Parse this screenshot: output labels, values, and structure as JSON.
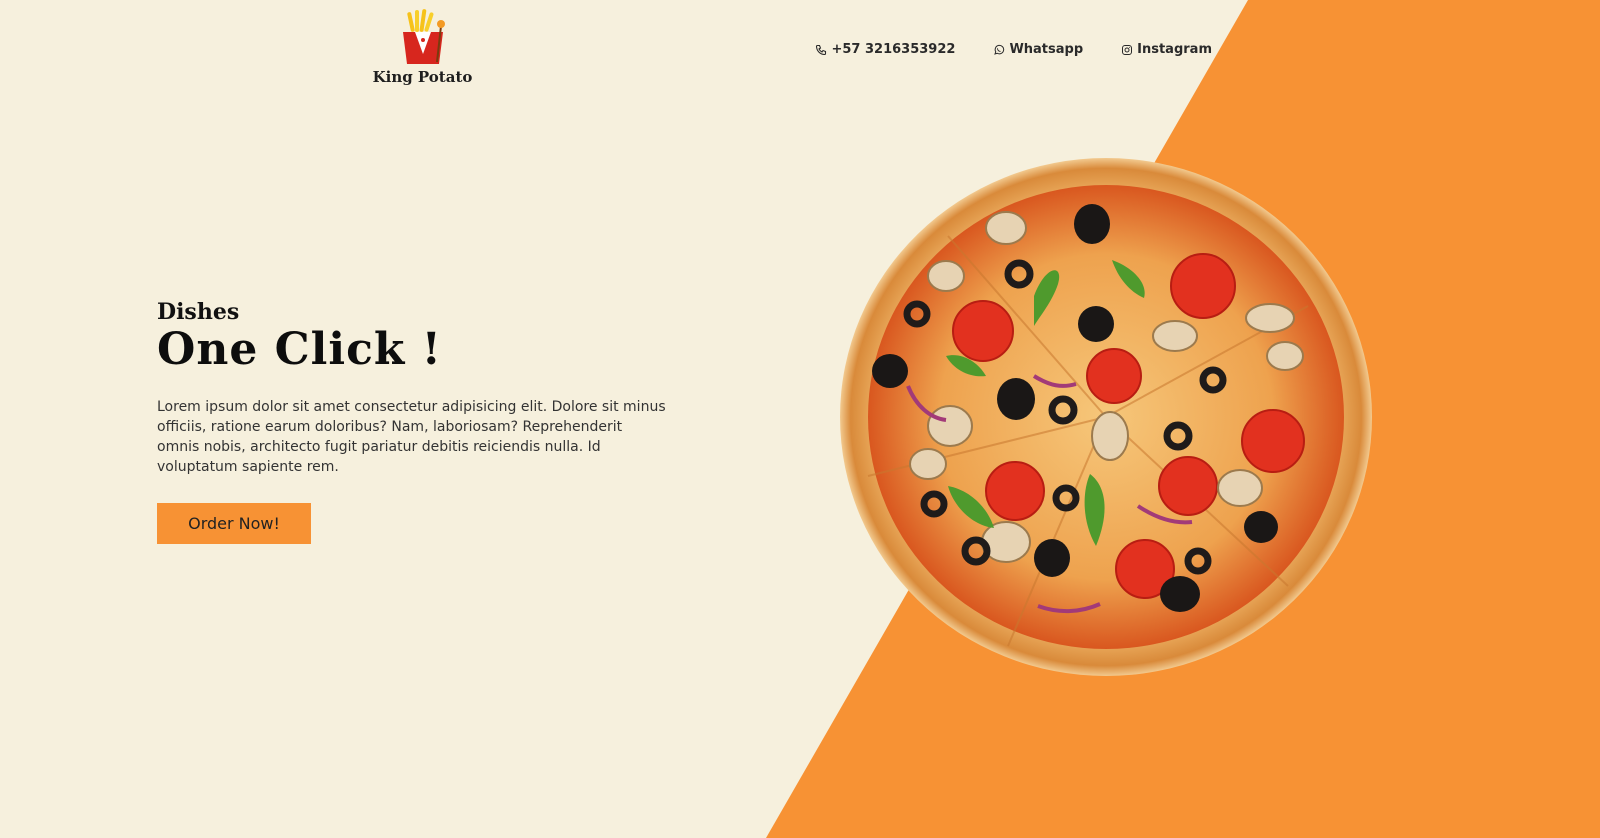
{
  "brand": {
    "name": "King Potato"
  },
  "nav": {
    "phone": "+57 3216353922",
    "whatsapp": "Whatsapp",
    "instagram": "Instagram"
  },
  "hero": {
    "eyebrow": "Dishes",
    "title": "One Click !",
    "description": "Lorem ipsum dolor sit amet consectetur adipisicing elit. Dolore sit minus officiis, ratione earum doloribus? Nam, laboriosam? Reprehenderit omnis nobis, architecto fugit pariatur debitis reiciendis nulla. Id voluptatum sapiente rem.",
    "cta_label": "Order Now!"
  },
  "theme": {
    "background": "#f6f0dd",
    "accent": "#f79234",
    "text": "#2b2b2b"
  },
  "icons": {
    "logo": "king-potato-fries-logo",
    "phone": "phone-icon",
    "whatsapp": "whatsapp-icon",
    "instagram": "instagram-icon",
    "hero_image": "pizza-image"
  }
}
